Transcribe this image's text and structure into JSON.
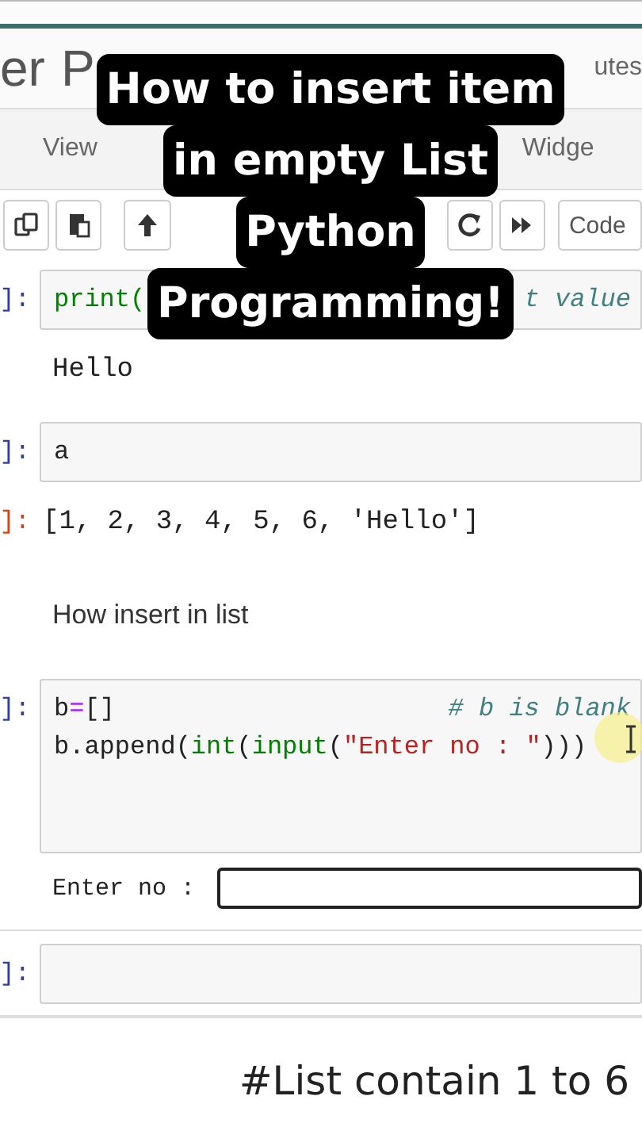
{
  "header": {
    "title_left": "er",
    "title_right": "P",
    "status": "utes"
  },
  "menu": [
    "View",
    "Widge"
  ],
  "toolbar": {
    "cell_type": "Code"
  },
  "cells": [
    {
      "kind": "code",
      "prompt": "]:",
      "lines": [
        {
          "tokens": [
            {
              "text": "print(",
              "kind": "builtin"
            }
          ],
          "comment": "t value"
        }
      ]
    },
    {
      "kind": "output",
      "text": "Hello"
    },
    {
      "kind": "code",
      "prompt": "]:",
      "lines": [
        {
          "tokens": [
            {
              "text": "a",
              "kind": "plain"
            }
          ]
        }
      ]
    },
    {
      "kind": "result",
      "prompt": "]:",
      "text": "[1, 2, 3, 4, 5, 6, 'Hello']"
    },
    {
      "kind": "markdown",
      "text": "How insert in list"
    },
    {
      "kind": "code",
      "prompt": "]:",
      "tall": true,
      "lines": [
        {
          "tokens": [
            {
              "text": "b",
              "kind": "plain"
            },
            {
              "text": "=",
              "kind": "operator"
            },
            {
              "text": "[]",
              "kind": "plain"
            }
          ],
          "comment": "# b is blank"
        },
        {
          "tokens": [
            {
              "text": "b.append(",
              "kind": "plain"
            },
            {
              "text": "int",
              "kind": "builtin"
            },
            {
              "text": "(",
              "kind": "plain"
            },
            {
              "text": "input",
              "kind": "builtin"
            },
            {
              "text": "(",
              "kind": "plain"
            },
            {
              "text": "\"Enter no : \"",
              "kind": "string"
            },
            {
              "text": ")))",
              "kind": "plain"
            }
          ]
        }
      ]
    },
    {
      "kind": "stdin",
      "label": "Enter no :"
    },
    {
      "kind": "code",
      "prompt": "]:"
    }
  ],
  "overlay_caption": [
    "How to insert item",
    "in empty List",
    "Python",
    "Programming!"
  ],
  "bottom_caption": "#List contain 1 to 6"
}
